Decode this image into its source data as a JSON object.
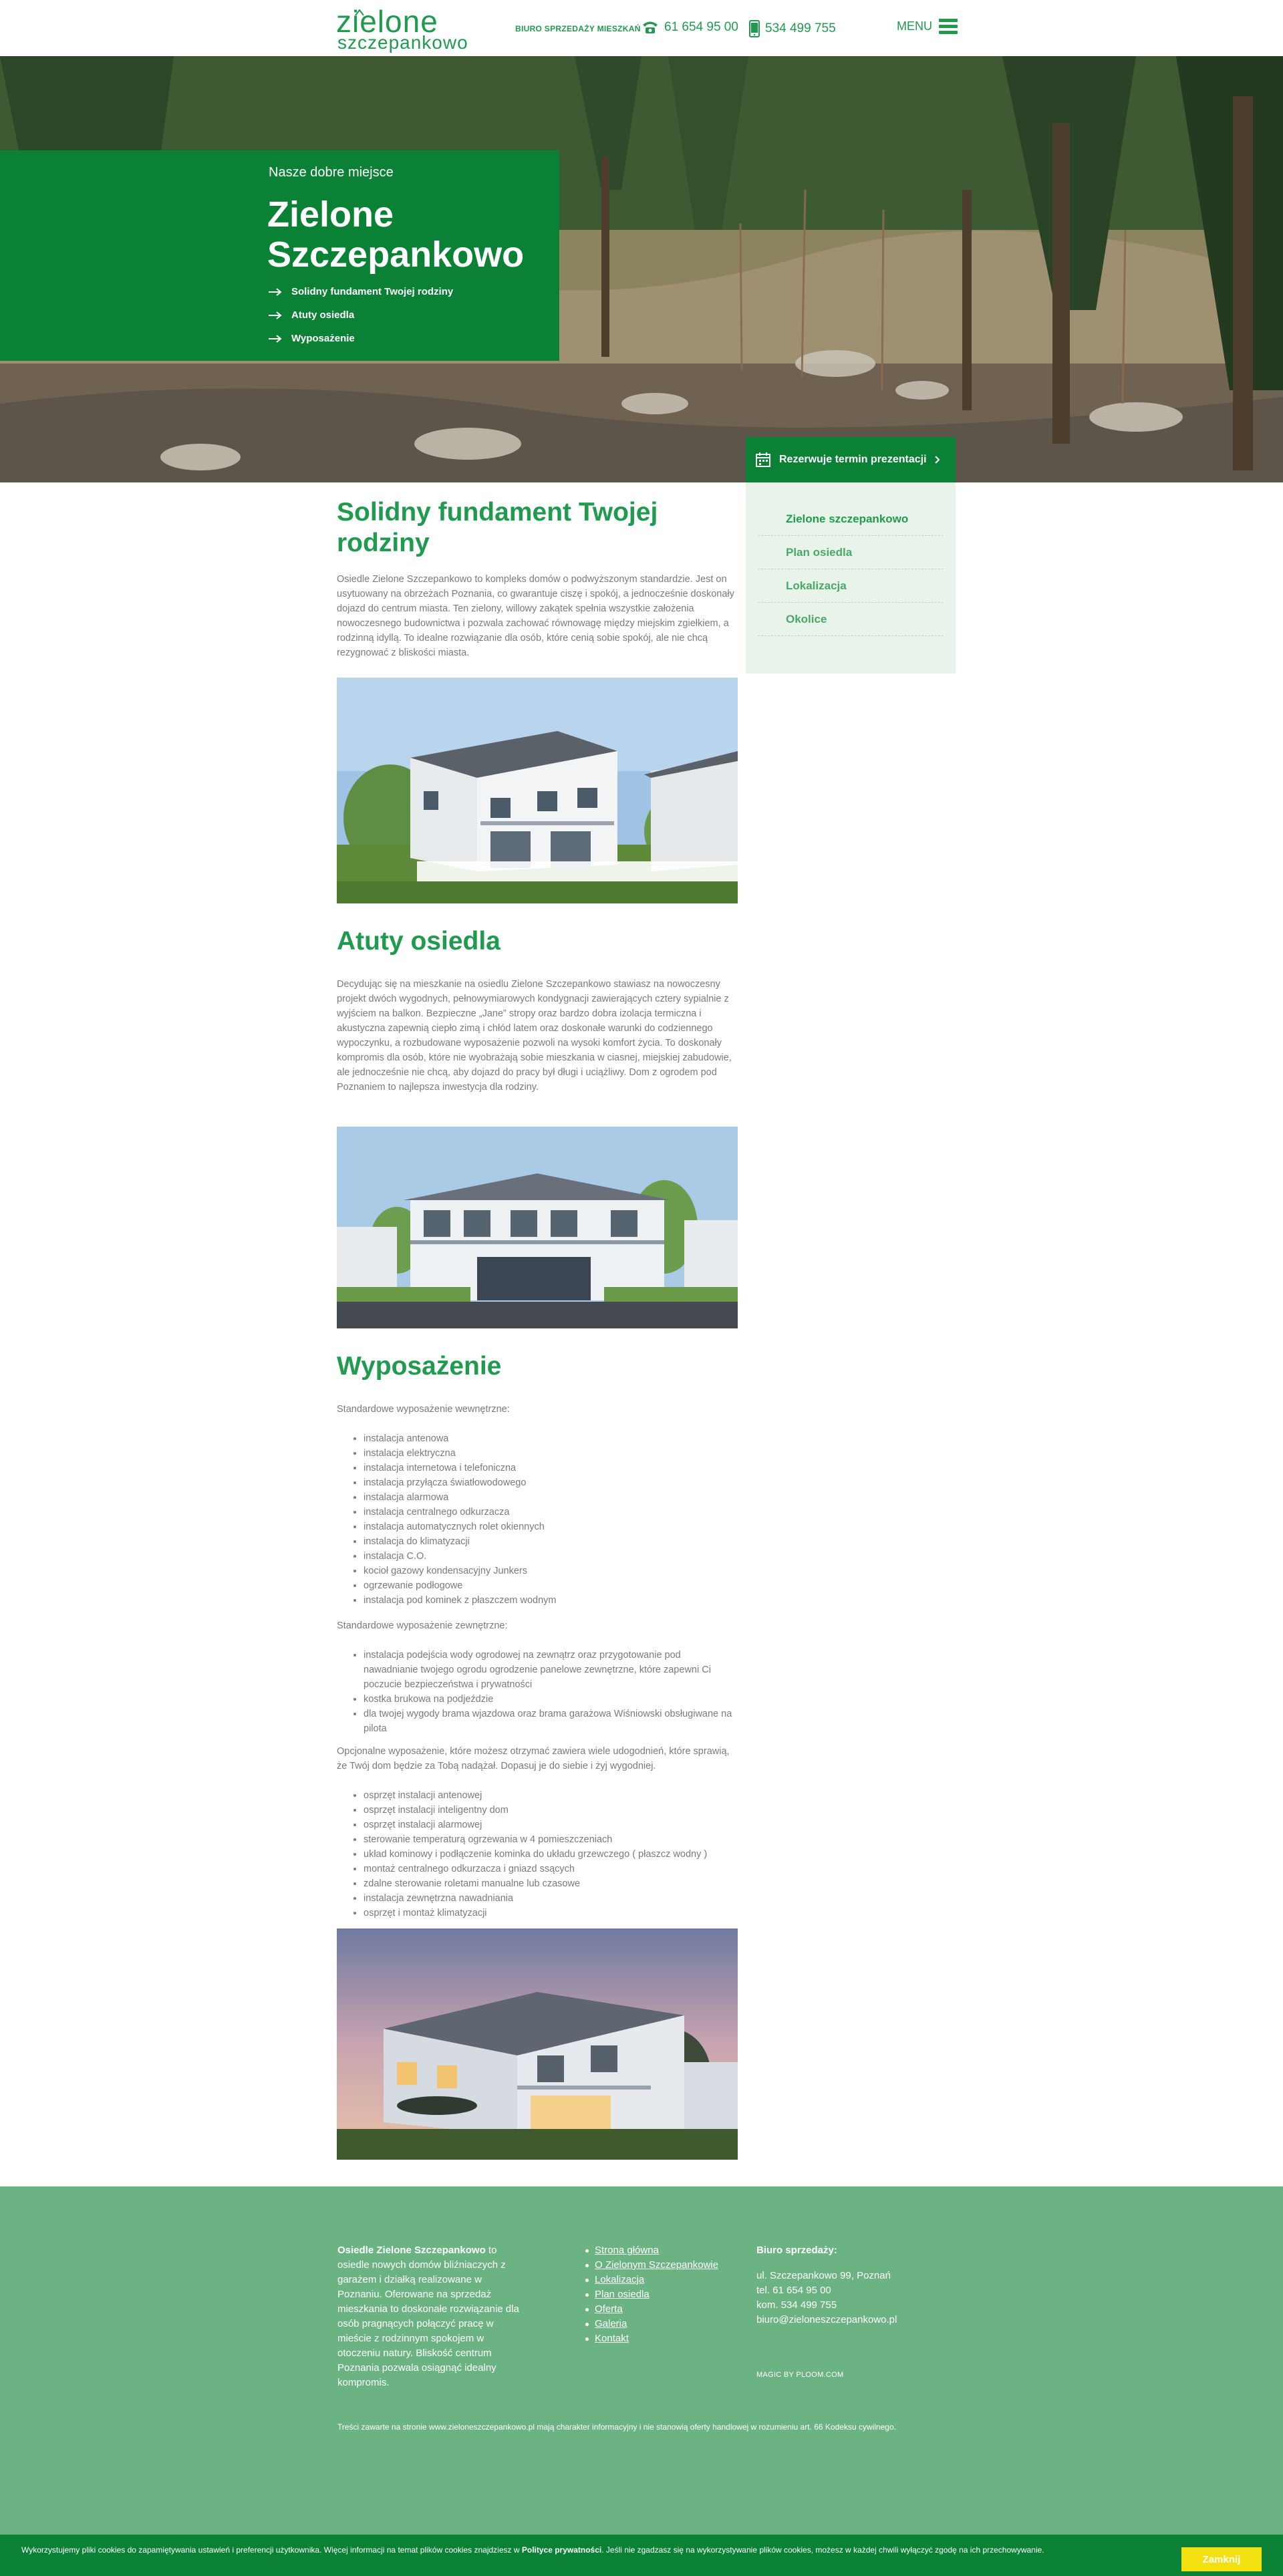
{
  "header": {
    "logo_top": "zielone",
    "logo_bottom": "szczepankowo",
    "sales_label": "BIURO SPRZEDAŻY MIESZKAŃ",
    "phone": "61 654 95 00",
    "mobile": "534 499 755",
    "menu_label": "MENU"
  },
  "hero": {
    "kicker": "Nasze dobre miejsce",
    "title": "Zielone Szczepankowo",
    "links": [
      "Solidny fundament Twojej rodziny",
      "Atuty osiedla",
      "Wyposażenie"
    ],
    "reserve_label": "Rezerwuje termin prezentacji"
  },
  "sidenav": {
    "items": [
      "Zielone szczepankowo",
      "Plan osiedla",
      "Lokalizacja",
      "Okolice"
    ]
  },
  "sections": {
    "s1_title": "Solidny fundament Twojej rodziny",
    "s1_text": "Osiedle Zielone Szczepankowo to kompleks domów o podwyższonym standardzie. Jest on usytuowany na obrzeżach Poznania, co gwarantuje ciszę i spokój, a jednocześnie doskonały dojazd do centrum miasta. Ten zielony, willowy zakątek spełnia wszystkie założenia nowoczesnego budownictwa i pozwala zachować równowagę między miejskim zgiełkiem, a rodzinną idyllą. To idealne rozwiązanie dla osób, które cenią sobie spokój, ale nie chcą rezygnować z bliskości miasta.",
    "s2_title": "Atuty osiedla",
    "s2_text": "Decydując się na mieszkanie na osiedlu Zielone Szczepankowo stawiasz na nowoczesny projekt dwóch wygodnych, pełnowymiarowych kondygnacji zawierających cztery sypialnie z wyjściem na balkon. Bezpieczne „Jane” stropy oraz bardzo dobra izolacja termiczna i akustyczna zapewnią ciepło zimą i chłód latem oraz doskonałe warunki do codziennego wypoczynku, a rozbudowane wyposażenie pozwoli na wysoki komfort życia. To doskonały kompromis dla osób, które nie wyobrażają sobie mieszkania w ciasnej, miejskiej zabudowie, ale jednocześnie nie chcą, aby dojazd do pracy był długi i uciążliwy. Dom z ogrodem pod Poznaniem to najlepsza inwestycja dla rodziny.",
    "s3_title": "Wyposażenie",
    "s3_intro1": "Standardowe wyposażenie wewnętrzne:",
    "s3_list1": [
      "instalacja antenowa",
      "instalacja elektryczna",
      "instalacja internetowa i telefoniczna",
      "instalacja przyłącza światłowodowego",
      "instalacja alarmowa",
      "instalacja centralnego odkurzacza",
      "instalacja automatycznych rolet okiennych",
      "instalacja do klimatyzacji",
      "instalacja C.O.",
      "kocioł gazowy kondensacyjny Junkers",
      "ogrzewanie podłogowe",
      "instalacja pod kominek z płaszczem wodnym"
    ],
    "s3_intro2": "Standardowe wyposażenie zewnętrzne:",
    "s3_list2": [
      "instalacja podejścia wody ogrodowej na zewnątrz oraz przygotowanie pod nawadnianie twojego ogrodu ogrodzenie panelowe zewnętrzne, które zapewni Ci poczucie bezpieczeństwa i prywatności",
      "kostka brukowa na podjeździe",
      "dla twojej wygody brama wjazdowa oraz brama garażowa Wiśniowski obsługiwane na pilota"
    ],
    "s3_intro3": "Opcjonalne wyposażenie, które możesz otrzymać zawiera wiele udogodnień, które sprawią, że Twój dom będzie za Tobą nadążał. Dopasuj je do siebie i żyj wygodniej.",
    "s3_list3": [
      "osprzęt instalacji antenowej",
      "osprzęt instalacji inteligentny dom",
      "osprzęt instalacji alarmowej",
      "sterowanie temperaturą ogrzewania w 4 pomieszczeniach",
      "układ kominowy i podłączenie kominka do układu grzewczego ( płaszcz wodny )",
      "montaż centralnego odkurzacza i gniazd ssących",
      "zdalne sterowanie roletami manualne lub czasowe",
      "instalacja zewnętrzna nawadniania",
      "osprzęt i montaż klimatyzacji"
    ]
  },
  "footer": {
    "about_bold": "Osiedle Zielone Szczepankowo",
    "about_text": " to osiedle nowych domów bliźniaczych z garażem i działką realizowane w Poznaniu. Oferowane na sprzedaż mieszkania to doskonałe rozwiązanie dla osób pragnących połączyć pracę w mieście z rodzinnym spokojem w otoczeniu natury. Bliskość centrum Poznania pozwala osiągnąć idealny kompromis.",
    "links": [
      "Strona główna",
      "O Zielonym Szczepankowie",
      "Lokalizacja",
      "Plan osiedla",
      "Oferta",
      "Galeria",
      "Kontakt"
    ],
    "sales_heading": "Biuro sprzedaży:",
    "sales_address": "ul. Szczepankowo 99, Poznań",
    "sales_tel": "tel. 61 654 95 00",
    "sales_mobile": "kom. 534 499 755",
    "sales_email": "biuro@zieloneszczepankowo.pl",
    "magic": "MAGIC BY PLOOM.COM",
    "notice": "Treści zawarte na stronie www.zieloneszczepankowo.pl mają charakter informacyjny i nie stanowią oferty handlowej w rozumieniu art. 66 Kodeksu cywilnego."
  },
  "cookie": {
    "text_pre": "Wykorzystujemy pliki cookies do zapamiętywania ustawień i preferencji użytkownika. Więcej informacji na temat plików cookies znajdziesz w ",
    "text_link": "Polityce prywatności",
    "text_post": ". Jeśli nie zgadzasz się na wykorzystywanie plików cookies, możesz w każdej chwili wyłączyć zgodę na ich przechowywanie.",
    "button": "Zamknij"
  },
  "colors": {
    "brand_green": "#1f9a4e",
    "dark_green": "#0b8136",
    "footer_green": "#6cb384",
    "cookie_button": "#f2e010"
  },
  "icons": [
    "phone-icon",
    "mobile-icon",
    "menu-icon",
    "arrow-right-icon",
    "calendar-icon",
    "chevron-right-icon"
  ]
}
